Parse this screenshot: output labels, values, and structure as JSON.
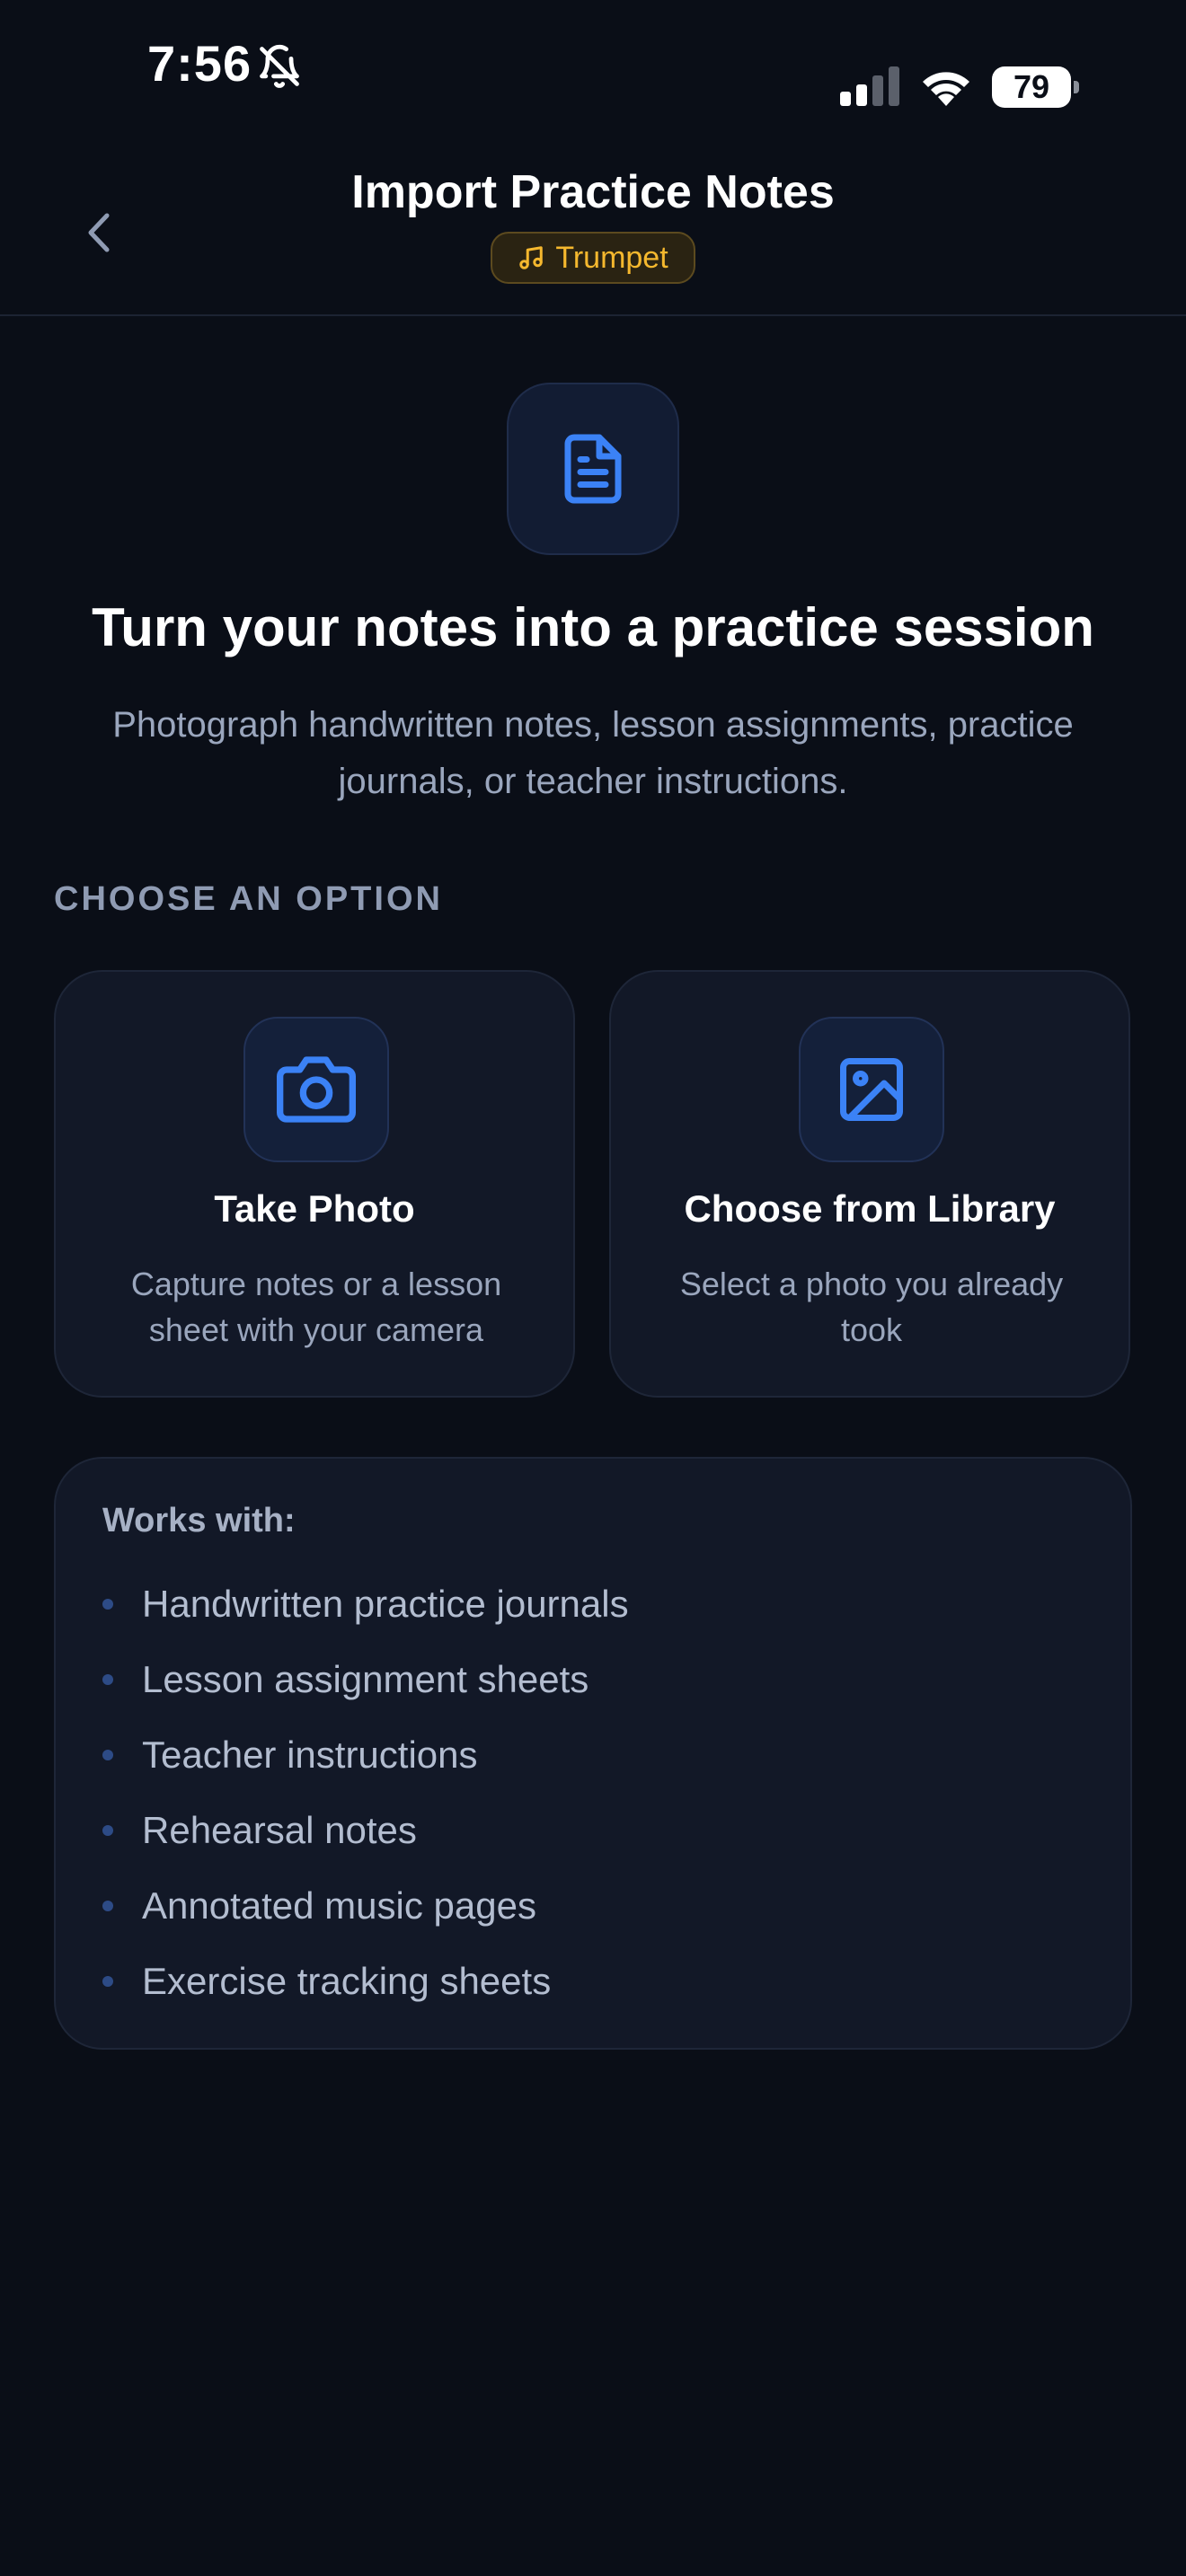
{
  "status_bar": {
    "time": "7:56",
    "battery": "79"
  },
  "header": {
    "title": "Import Practice Notes",
    "instrument": "Trumpet"
  },
  "hero": {
    "title": "Turn your notes into a practice session",
    "subtitle": "Photograph handwritten notes, lesson assignments, practice journals, or teacher instructions."
  },
  "options": {
    "section_label": "CHOOSE AN OPTION",
    "take_photo": {
      "title": "Take Photo",
      "description": "Capture notes or a lesson sheet with your camera",
      "icon": "camera-icon"
    },
    "library": {
      "title": "Choose from Library",
      "description": "Select a photo you already took",
      "icon": "image-icon"
    }
  },
  "works_with": {
    "title": "Works with:",
    "items": [
      "Handwritten practice journals",
      "Lesson assignment sheets",
      "Teacher instructions",
      "Rehearsal notes",
      "Annotated music pages",
      "Exercise tracking sheets"
    ]
  },
  "colors": {
    "background": "#0a0e17",
    "card": "#121827",
    "accent_blue": "#3b82f6",
    "accent_amber": "#f5b82e"
  }
}
